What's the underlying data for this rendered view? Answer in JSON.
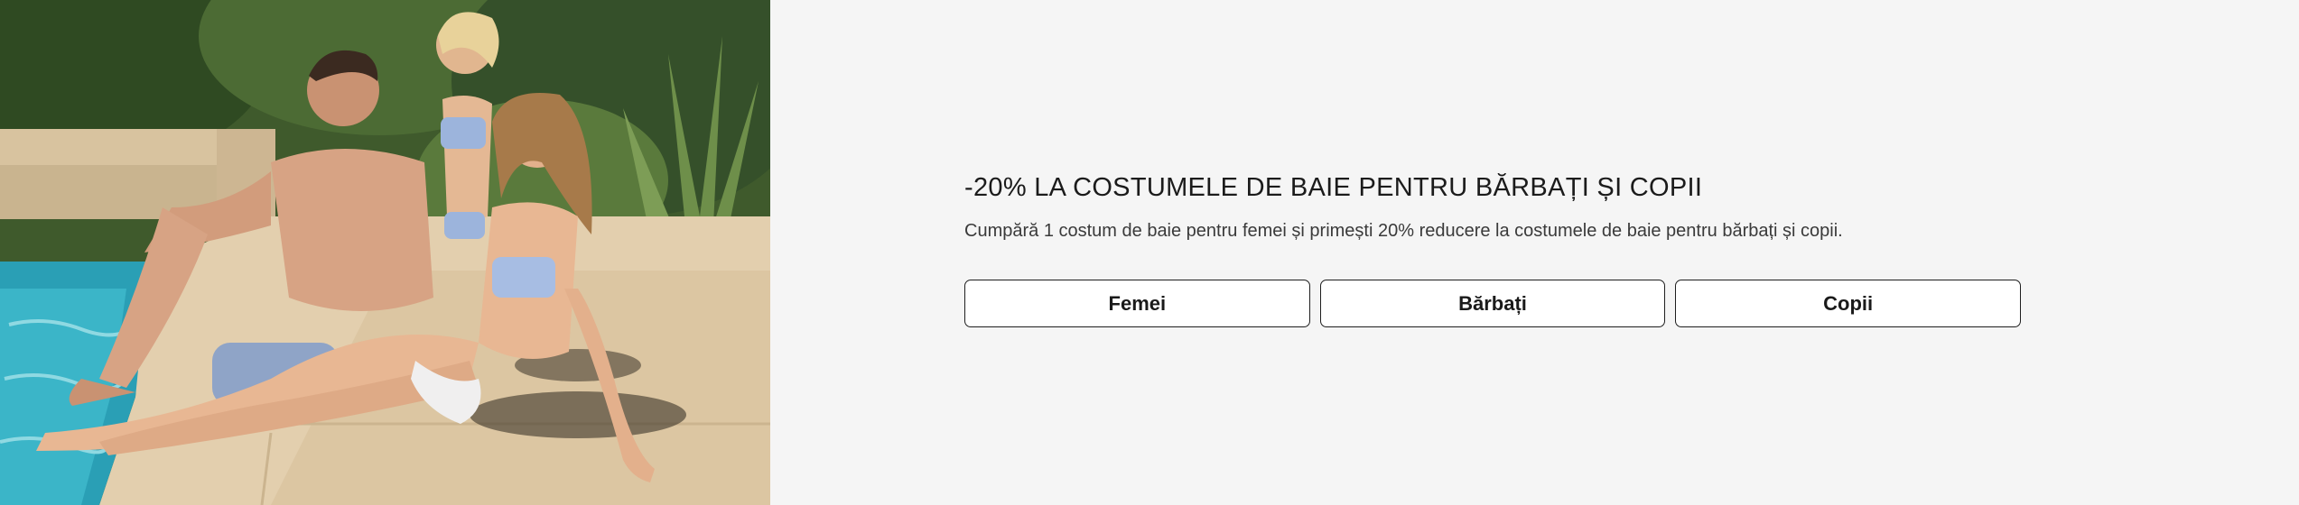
{
  "promo": {
    "headline": "-20% LA COSTUMELE DE BAIE PENTRU BĂRBAȚI ȘI COPII",
    "description": "Cumpără 1 costum de baie  pentru femei și primești 20% reducere la costumele de baie pentru bărbați și copii.",
    "buttons": [
      {
        "label": "Femei"
      },
      {
        "label": "Bărbați"
      },
      {
        "label": "Copii"
      }
    ]
  },
  "colors": {
    "panel_background": "#f5f5f5",
    "button_border": "#1f1f1f",
    "text": "#1a1a1a"
  }
}
